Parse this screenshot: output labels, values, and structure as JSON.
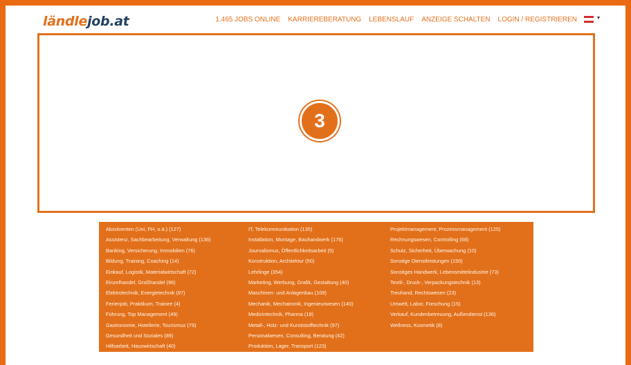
{
  "logo": {
    "part1": "ländle",
    "part2": "job.at"
  },
  "nav": {
    "jobs_online": "1.465 JOBS ONLINE",
    "items": [
      "KARRIEREBERATUNG",
      "LEBENSLAUF",
      "ANZEIGE SCHALTEN",
      "LOGIN / REGISTRIEREN"
    ]
  },
  "language": {
    "icon": "austria-flag-icon",
    "caret": "▾"
  },
  "banner": {
    "step": "3"
  },
  "categories": {
    "col1": [
      "Absolventen (Uni, FH, o.ä.) (127)",
      "Assistenz, Sachbearbeitung, Verwaltung (136)",
      "Banking, Versicherung, Immobilien (76)",
      "Bildung, Training, Coaching (14)",
      "Einkauf, Logistik, Materialwirtschaft (72)",
      "Einzelhandel, Großhandel (96)",
      "Elektrotechnik, Energietechnik (97)",
      "Ferienjob, Praktikum, Trainee (4)",
      "Führung, Top Management (49)",
      "Gastronomie, Hotellerie, Tourismus (79)",
      "Gesundheit und Soziales (89)",
      "Hilfsarbeit, Hauswirtschaft (40)"
    ],
    "col2": [
      "IT, Telekommunikation (135)",
      "Installation, Montage, Bauhandwerk (176)",
      "Journalismus, Öffentlichkeitsarbeit (5)",
      "Konstruktion, Architektur (50)",
      "Lehrlinge (354)",
      "Marketing, Werbung, Grafik, Gestaltung (40)",
      "Maschinen- und Anlagenbau (109)",
      "Mechanik, Mechatronik, Ingenieurwesen (140)",
      "Medizintechnik, Pharma (18)",
      "Metall-, Holz- und Kunststofftechnik (97)",
      "Personalwesen, Consulting, Beratung (42)",
      "Produktion, Lager, Transport (123)"
    ],
    "col3": [
      "Projektmanagement, Prozessmanagement (125)",
      "Rechnungswesen, Controlling (68)",
      "Schutz, Sicherheit, Überwachung (10)",
      "Sonstige Dienstleistungen (150)",
      "Sonstiges Handwerk, Lebensmittelindustrie (73)",
      "Textil-, Druck-, Verpackungstechnik (13)",
      "Treuhand, Rechtswesen (23)",
      "Umwelt, Labor, Forschung (15)",
      "Verkauf, Kundenbetreuung, Außendienst (136)",
      "Wellness, Kosmetik (8)"
    ]
  },
  "colors": {
    "accent": "#e2701b",
    "logo_dark": "#24415f",
    "background": "#ffffff"
  }
}
